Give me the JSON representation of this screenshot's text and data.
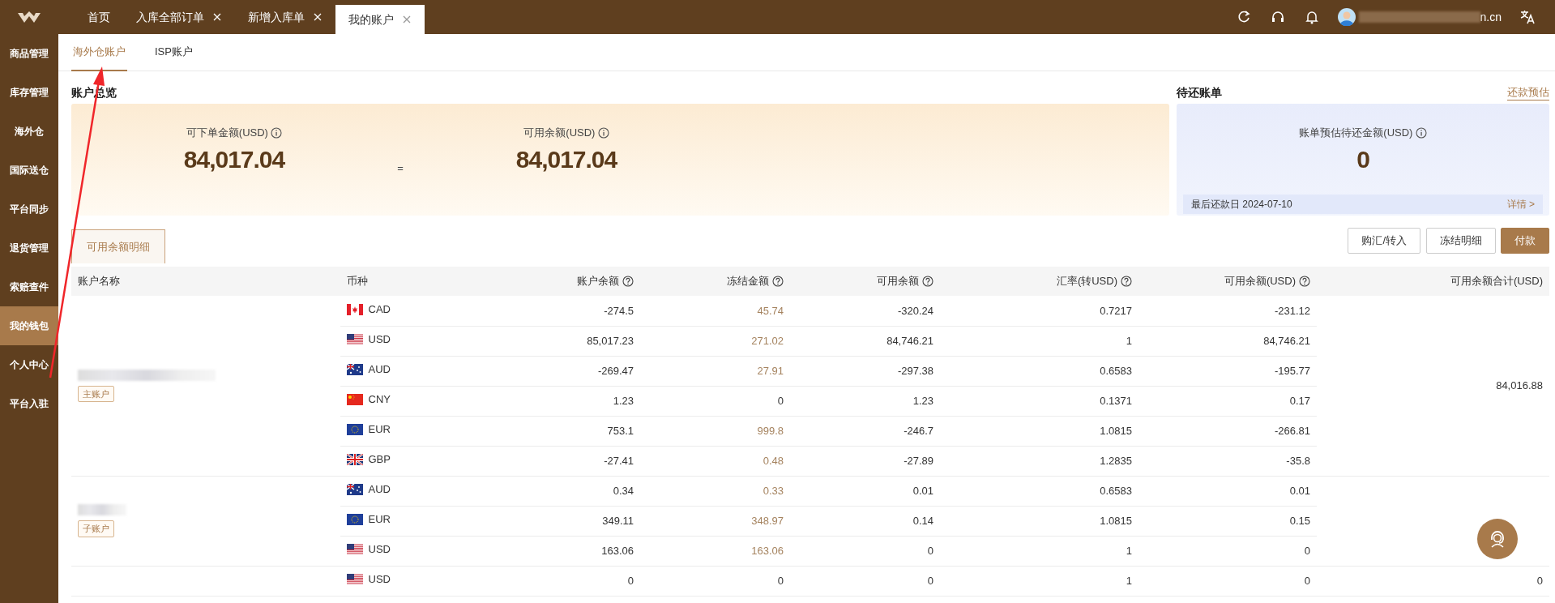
{
  "header": {
    "tabs": [
      {
        "label": "首页",
        "closable": false,
        "selected": false
      },
      {
        "label": "入库全部订单",
        "closable": true,
        "selected": false
      },
      {
        "label": "新增入库单",
        "closable": true,
        "selected": false
      },
      {
        "label": "我的账户",
        "closable": true,
        "selected": true
      }
    ],
    "user": {
      "email_visible": "n.cn"
    }
  },
  "sidebar": {
    "items": [
      {
        "label": "商品管理",
        "selected": false
      },
      {
        "label": "库存管理",
        "selected": false
      },
      {
        "label": "海外仓",
        "selected": false
      },
      {
        "label": "国际送仓",
        "selected": false
      },
      {
        "label": "平台同步",
        "selected": false
      },
      {
        "label": "退货管理",
        "selected": false
      },
      {
        "label": "索赔查件",
        "selected": false
      },
      {
        "label": "我的钱包",
        "selected": true
      },
      {
        "label": "个人中心",
        "selected": false
      },
      {
        "label": "平台入驻",
        "selected": false
      }
    ]
  },
  "sub_tabs": [
    {
      "label": "海外仓账户",
      "selected": true
    },
    {
      "label": "ISP账户",
      "selected": false
    }
  ],
  "overview": {
    "title": "账户总览",
    "operator": "=",
    "items": [
      {
        "label": "可下单金额(USD)",
        "value": "84,017.04"
      },
      {
        "label": "可用余额(USD)",
        "value": "84,017.04"
      }
    ]
  },
  "pending": {
    "title": "待还账单",
    "link": "还款预估",
    "label": "账单预估待还金额(USD)",
    "value": "0",
    "last_date": "最后还款日 2024-07-10",
    "details": "详情 >"
  },
  "detail_tabs": [
    {
      "label": "可用余额明细",
      "selected": true
    }
  ],
  "actions": [
    {
      "label": "购汇/转入",
      "kind": "outline"
    },
    {
      "label": "冻结明细",
      "kind": "outline"
    },
    {
      "label": "付款",
      "kind": "primary"
    }
  ],
  "table": {
    "columns": [
      {
        "label": "账户名称",
        "help": false
      },
      {
        "label": "币种",
        "help": false
      },
      {
        "label": "账户余额",
        "help": true
      },
      {
        "label": "冻结金额",
        "help": true
      },
      {
        "label": "可用余额",
        "help": true
      },
      {
        "label": "汇率(转USD)",
        "help": true
      },
      {
        "label": "可用余额(USD)",
        "help": true
      },
      {
        "label": "可用余额合计(USD)",
        "help": false
      }
    ],
    "groups": [
      {
        "name_redacted": true,
        "tag": "主账户",
        "total": "84,016.88",
        "rows": [
          {
            "kind": "ca",
            "currency": "CAD",
            "balance": "-274.5",
            "frozen": "45.74",
            "frozen_highlight": true,
            "available": "-320.24",
            "rate": "0.7217",
            "available_usd": "-231.12"
          },
          {
            "kind": "us",
            "currency": "USD",
            "balance": "85,017.23",
            "frozen": "271.02",
            "frozen_highlight": true,
            "available": "84,746.21",
            "rate": "1",
            "available_usd": "84,746.21"
          },
          {
            "kind": "au",
            "currency": "AUD",
            "balance": "-269.47",
            "frozen": "27.91",
            "frozen_highlight": true,
            "available": "-297.38",
            "rate": "0.6583",
            "available_usd": "-195.77"
          },
          {
            "kind": "cn",
            "currency": "CNY",
            "balance": "1.23",
            "frozen": "0",
            "frozen_highlight": false,
            "available": "1.23",
            "rate": "0.1371",
            "available_usd": "0.17"
          },
          {
            "kind": "eu",
            "currency": "EUR",
            "balance": "753.1",
            "frozen": "999.8",
            "frozen_highlight": true,
            "available": "-246.7",
            "rate": "1.0815",
            "available_usd": "-266.81"
          },
          {
            "kind": "gb",
            "currency": "GBP",
            "balance": "-27.41",
            "frozen": "0.48",
            "frozen_highlight": true,
            "available": "-27.89",
            "rate": "1.2835",
            "available_usd": "-35.8"
          }
        ]
      },
      {
        "name_redacted": true,
        "tag": "子账户",
        "rows": [
          {
            "kind": "au",
            "currency": "AUD",
            "balance": "0.34",
            "frozen": "0.33",
            "frozen_highlight": true,
            "available": "0.01",
            "rate": "0.6583",
            "available_usd": "0.01"
          },
          {
            "kind": "eu",
            "currency": "EUR",
            "balance": "349.11",
            "frozen": "348.97",
            "frozen_highlight": true,
            "available": "0.14",
            "rate": "1.0815",
            "available_usd": "0.15"
          },
          {
            "kind": "us",
            "currency": "USD",
            "balance": "163.06",
            "frozen": "163.06",
            "frozen_highlight": true,
            "available": "0",
            "rate": "1",
            "available_usd": "0"
          }
        ]
      },
      {
        "total": "0",
        "rows": [
          {
            "kind": "us",
            "currency": "USD",
            "balance": "0",
            "frozen": "0",
            "frozen_highlight": false,
            "available": "0",
            "rate": "1",
            "available_usd": "0"
          }
        ]
      }
    ]
  },
  "annotation": {
    "arrow": true
  }
}
